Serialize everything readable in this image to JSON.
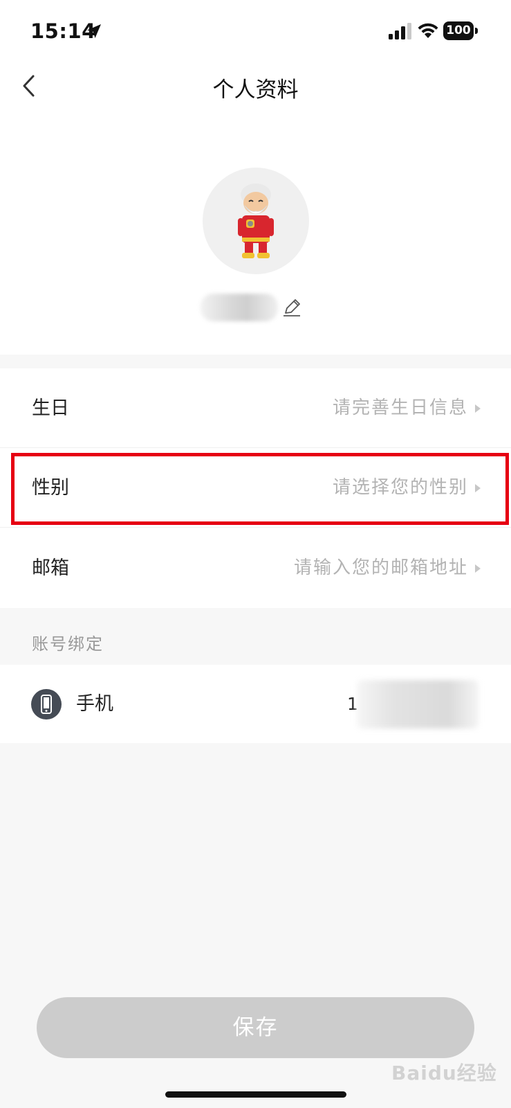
{
  "status_bar": {
    "time": "15:14",
    "battery": "100"
  },
  "nav": {
    "title": "个人资料"
  },
  "profile": {
    "nickname": ""
  },
  "info_rows": [
    {
      "label": "生日",
      "value": "请完善生日信息"
    },
    {
      "label": "性别",
      "value": "请选择您的性别"
    },
    {
      "label": "邮箱",
      "value": "请输入您的邮箱地址"
    }
  ],
  "account_binding": {
    "section_title": "账号绑定",
    "phone_label": "手机",
    "phone_value": "1"
  },
  "save_button": {
    "label": "保存"
  },
  "watermark": {
    "text": "Baidu经验"
  },
  "colors": {
    "highlight": "#e60012",
    "save_disabled": "#cccccc",
    "placeholder": "#b3b3b3"
  }
}
